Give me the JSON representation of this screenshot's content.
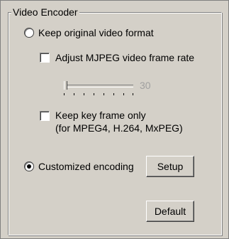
{
  "group": {
    "title": "Video Encoder"
  },
  "options": {
    "keep_original": {
      "label": "Keep original video format",
      "checked": false
    },
    "adjust_mjpeg": {
      "label": "Adjust MJPEG video frame rate",
      "checked": false
    },
    "frame_rate": {
      "value": "30",
      "fraction": 0.0,
      "enabled": false
    },
    "keep_key_frame": {
      "label_line1": "Keep key frame only",
      "label_line2": "(for MPEG4, H.264, MxPEG)",
      "checked": false
    },
    "customized": {
      "label": "Customized encoding",
      "checked": true
    }
  },
  "buttons": {
    "setup_label": "Setup",
    "default_label": "Default"
  }
}
